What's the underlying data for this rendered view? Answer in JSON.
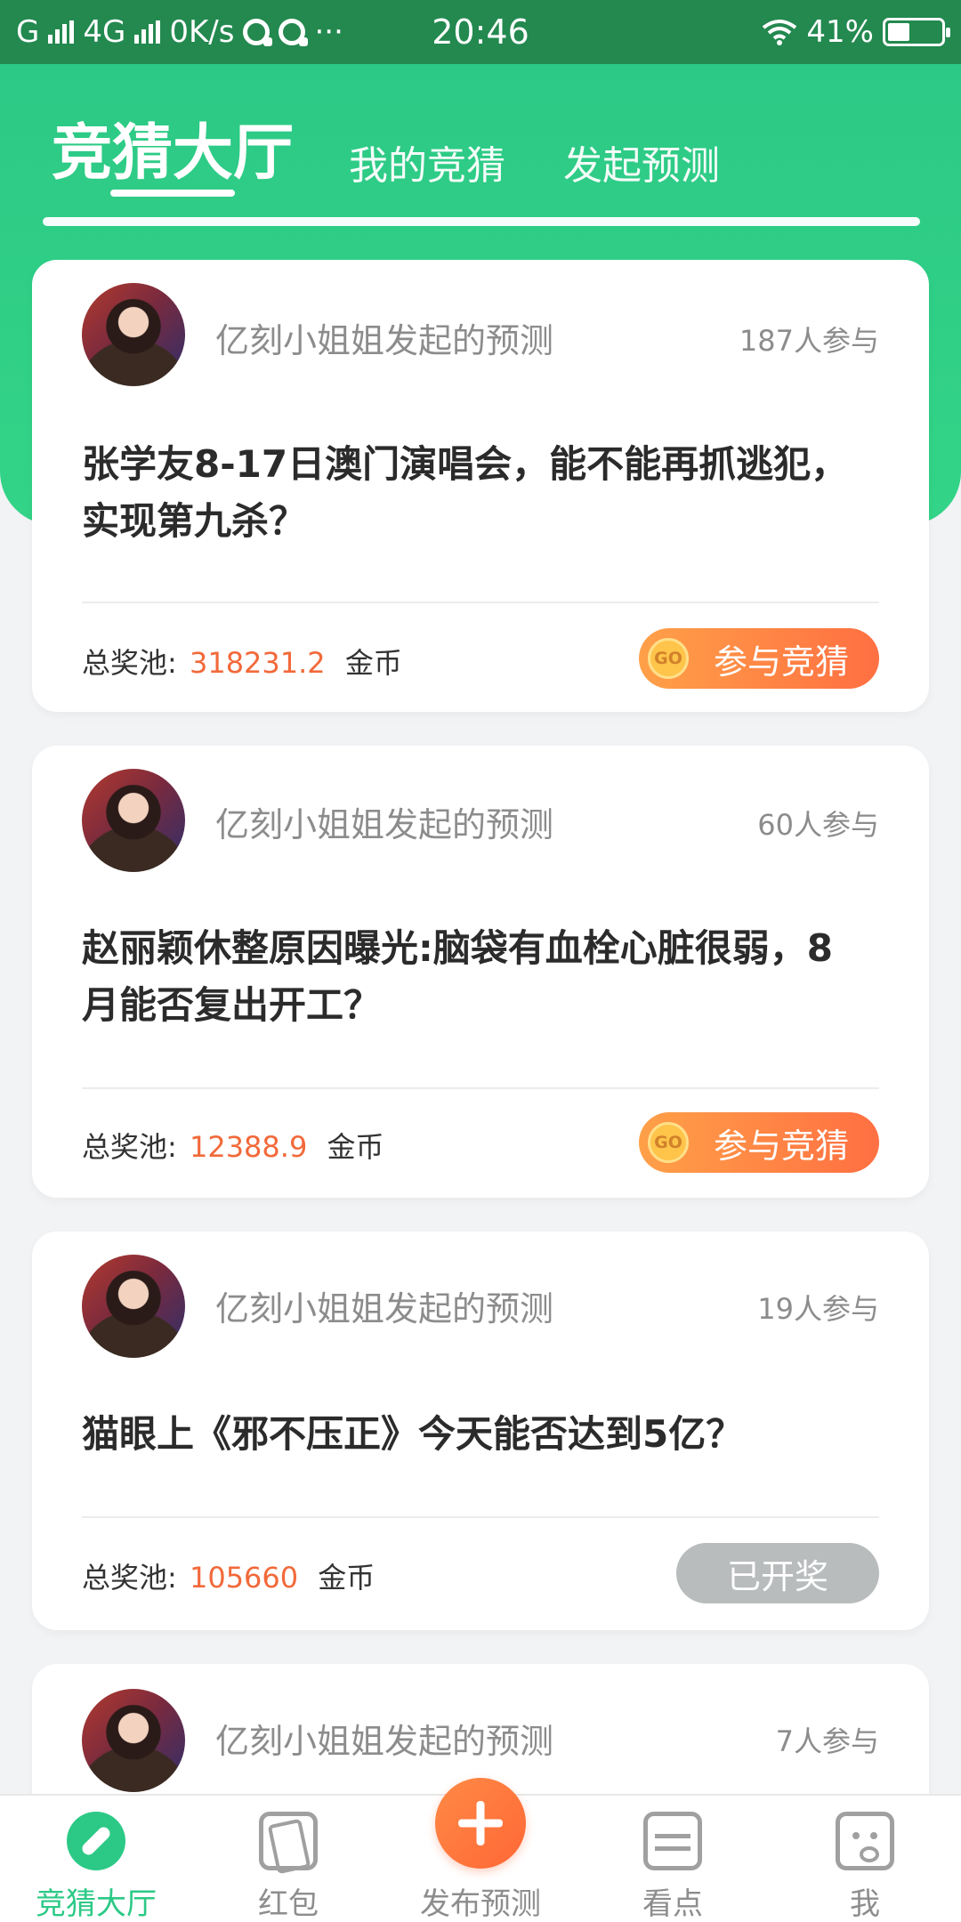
{
  "status_bar": {
    "carrier_left": "G",
    "network": "4G",
    "speed": "0K/s",
    "more": "···",
    "time": "20:46",
    "battery": "41%"
  },
  "tabs": {
    "active": "竞猜大厅",
    "my_guess": "我的竞猜",
    "start_prediction": "发起预测"
  },
  "cards": [
    {
      "initiator": "亿刻小姐姐发起的预测",
      "participants": "187人参与",
      "question": "张学友8-17日澳门演唱会，能不能再抓逃犯，实现第九杀？",
      "pool_label": "总奖池:",
      "pool_amount": "318231.2",
      "pool_unit": "金币",
      "action_label": "参与竞猜",
      "go_label": "GO"
    },
    {
      "initiator": "亿刻小姐姐发起的预测",
      "participants": "60人参与",
      "question": "赵丽颖休整原因曝光:脑袋有血栓心脏很弱，8月能否复出开工？",
      "pool_label": "总奖池:",
      "pool_amount": "12388.9",
      "pool_unit": "金币",
      "action_label": "参与竞猜",
      "go_label": "GO"
    },
    {
      "initiator": "亿刻小姐姐发起的预测",
      "participants": "19人参与",
      "question": "猫眼上《邪不压正》今天能否达到5亿？",
      "pool_label": "总奖池:",
      "pool_amount": "105660",
      "pool_unit": "金币",
      "action_label": "已开奖"
    },
    {
      "initiator": "亿刻小姐姐发起的预测",
      "participants": "7人参与"
    }
  ],
  "tabbar": {
    "hall": "竞猜大厅",
    "red_packet": "红包",
    "publish": "发布预测",
    "highlights": "看点",
    "me": "我"
  },
  "colors": {
    "brand_green": "#2cc986",
    "status_bar": "#23894f",
    "accent_orange": "#ff6f42",
    "amount_orange": "#f2693a",
    "disabled_gray": "#b9bcbd"
  },
  "icons": {
    "hall": "compass-icon",
    "red_packet": "red-packet-icon",
    "publish": "plus-icon",
    "highlights": "news-icon",
    "me": "profile-icon"
  }
}
